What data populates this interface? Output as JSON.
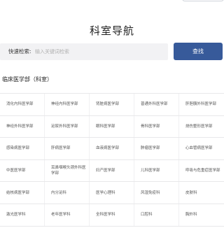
{
  "header": {
    "title": "科室导航"
  },
  "search": {
    "label": "快速检索:",
    "placeholder": "输入关键词检索",
    "button_label": "查找"
  },
  "section": {
    "title": "临床医学部（科室）"
  },
  "departments": [
    [
      "消化内科医学部",
      "神经内科医学部",
      "肾脏病医学部",
      "普通外科医学部",
      "肝胆胰外科医学部"
    ],
    [
      "神经外科医学部",
      "泌尿外科医学部",
      "眼科医学部",
      "骨科医学部",
      "烧伤整形医学部"
    ],
    [
      "感染病医学部",
      "肝病医学部",
      "血液病医学部",
      "肿瘤医学部",
      "心血管病医学部"
    ],
    [
      "中医医学部",
      "耳鼻咽喉头颈外科医学部",
      "妇产医学部",
      "儿科医学部",
      "呼吸与危重症医学部"
    ],
    [
      "结核病医学部",
      "内分泌科",
      "医学心理科",
      "风湿免疫科",
      "皮肤科"
    ],
    [
      "激光医学科",
      "老年医学科",
      "全科医学科",
      "口腔科",
      "胸外科"
    ]
  ]
}
